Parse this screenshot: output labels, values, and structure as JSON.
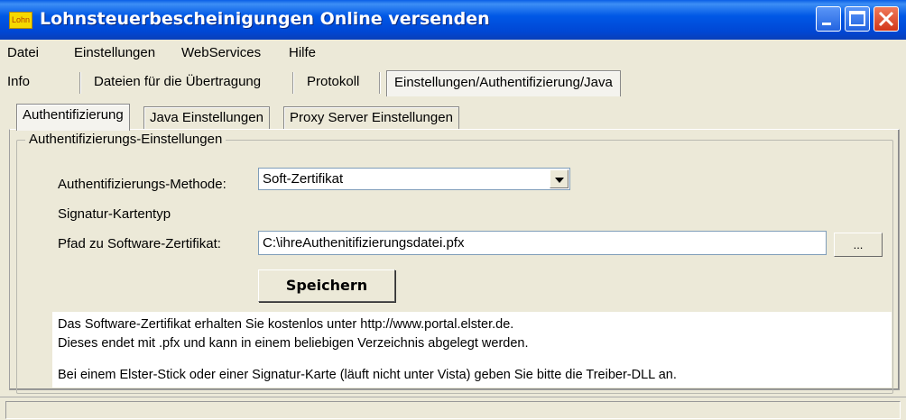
{
  "window": {
    "icon_text": "Lohn",
    "title": "Lohnsteuerbescheinigungen Online versenden"
  },
  "menu": [
    "Datei",
    "Einstellungen",
    "WebServices",
    "Hilfe"
  ],
  "main_tabs": [
    "Info",
    "Dateien für die Übertragung",
    "Protokoll",
    "Einstellungen/Authentifizierung/Java"
  ],
  "sub_tabs": [
    "Authentifizierung",
    "Java Einstellungen",
    "Proxy Server Einstellungen"
  ],
  "group": {
    "title": "Authentifizierungs-Einstellungen",
    "method_label": "Authentifizierungs-Methode:",
    "method_value": "Soft-Zertifikat",
    "card_type_label": "Signatur-Kartentyp",
    "path_label": "Pfad zu Software-Zertifikat:",
    "path_value": "C:\\ihreAuthenitifizierungsdatei.pfx",
    "browse_label": "...",
    "save_label": "Speichern"
  },
  "info": {
    "line1": "Das Software-Zertifikat erhalten Sie kostenlos unter http://www.portal.elster.de.",
    "line2": "Dieses endet mit .pfx und kann in einem beliebigen Verzeichnis abgelegt werden.",
    "line3": "Bei einem Elster-Stick oder einer Signatur-Karte (läuft nicht unter Vista) geben Sie bitte die Treiber-DLL an."
  },
  "colors": {
    "titlebar": "#0058e6",
    "window_bg": "#ece9d8",
    "close_button": "#d2361a"
  }
}
